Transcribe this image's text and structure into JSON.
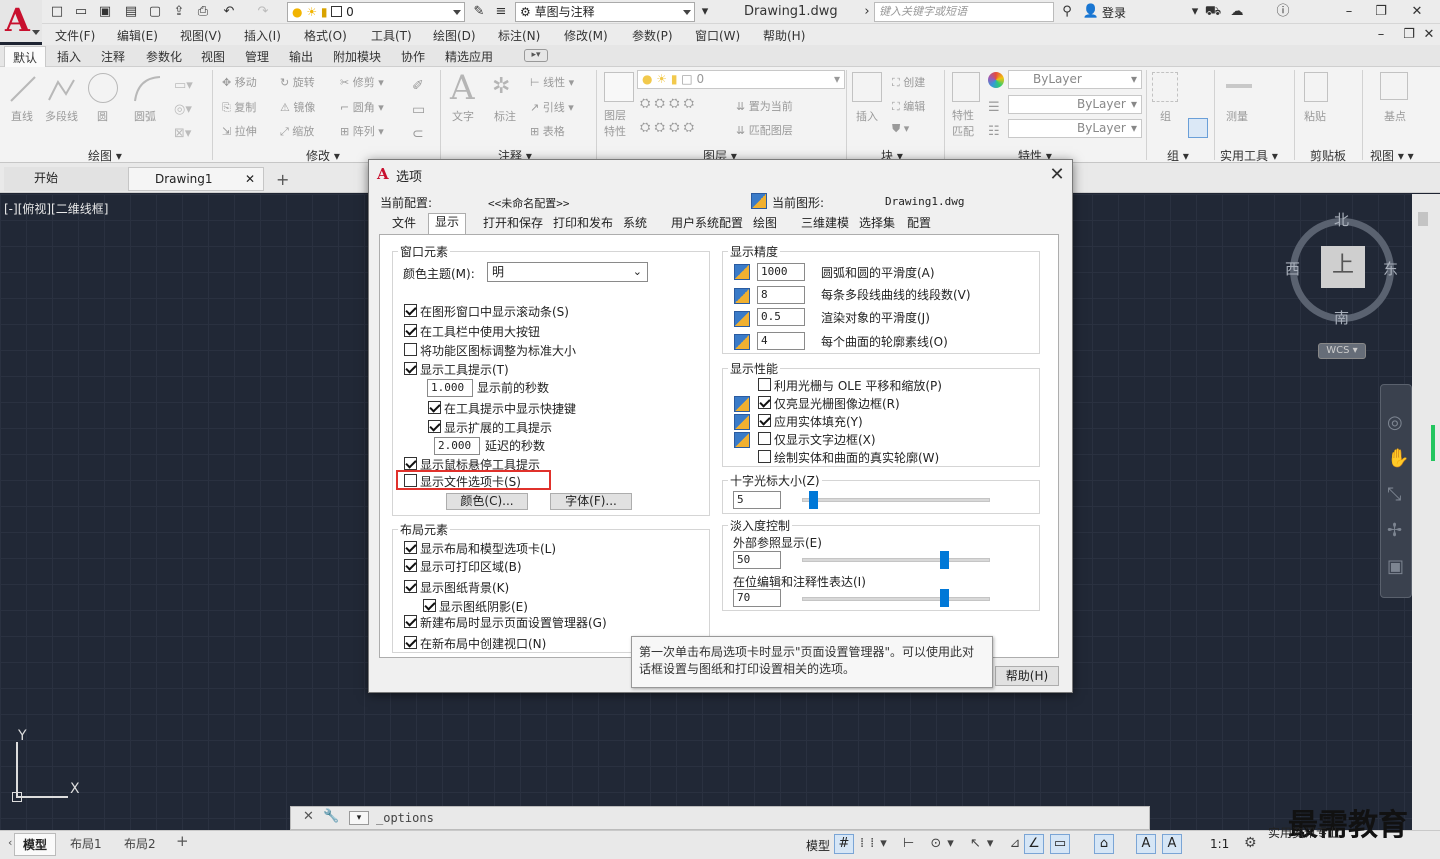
{
  "titlebar": {
    "workspace": "草图与注释",
    "layer_value": "0",
    "doc_title": "Drawing1.dwg",
    "search_placeholder": "键入关键字或短语",
    "login": "登录"
  },
  "menubar": [
    "文件(F)",
    "编辑(E)",
    "视图(V)",
    "插入(I)",
    "格式(O)",
    "工具(T)",
    "绘图(D)",
    "标注(N)",
    "修改(M)",
    "参数(P)",
    "窗口(W)",
    "帮助(H)"
  ],
  "ribbon_tabs": [
    "默认",
    "插入",
    "注释",
    "参数化",
    "视图",
    "管理",
    "输出",
    "附加模块",
    "协作",
    "精选应用"
  ],
  "ribbon": {
    "draw": {
      "title": "绘图",
      "items": [
        "直线",
        "多段线",
        "圆",
        "圆弧"
      ]
    },
    "modify": {
      "title": "修改",
      "items": [
        "移动",
        "旋转",
        "修剪",
        "复制",
        "镜像",
        "圆角",
        "拉伸",
        "缩放",
        "阵列"
      ]
    },
    "annotation": {
      "title": "注释",
      "items": [
        "文字",
        "标注",
        "线性",
        "引线",
        "表格"
      ]
    },
    "layers": {
      "title": "图层",
      "items": [
        "图层特性",
        "置为当前",
        "匹配图层"
      ],
      "value": "0"
    },
    "block": {
      "title": "块",
      "items": [
        "插入",
        "创建",
        "编辑"
      ]
    },
    "properties": {
      "title": "特性",
      "items": [
        "特性匹配"
      ],
      "bylayer": [
        "ByLayer",
        "ByLayer",
        "ByLayer"
      ]
    },
    "groups": {
      "title": "组",
      "item": "组"
    },
    "utilities": {
      "title": "实用工具",
      "item": "测量"
    },
    "clipboard": {
      "title": "剪贴板",
      "item": "粘贴"
    },
    "view": {
      "title": "视图",
      "item": "基点"
    }
  },
  "doc_tabs": [
    "开始",
    "Drawing1"
  ],
  "viewport": {
    "label": "[-][俯视][二维线框]"
  },
  "viewcube": {
    "north": "北",
    "south": "南",
    "east": "东",
    "west": "西",
    "top": "上",
    "wcs": "WCS"
  },
  "ucs": {
    "x": "X",
    "y": "Y"
  },
  "command": {
    "input": "_options"
  },
  "status": {
    "layout_tabs": [
      "模型",
      "布局1",
      "布局2"
    ],
    "model": "模型",
    "scale": "1:1"
  },
  "watermark": {
    "main": "最需教育",
    "sub": "实用资讯专业"
  },
  "dialog": {
    "title": "选项",
    "current_profile_label": "当前配置:",
    "current_profile_value": "<<未命名配置>>",
    "current_drawing_label": "当前图形:",
    "current_drawing_value": "Drawing1.dwg",
    "tabs": [
      "文件",
      "显示",
      "打开和保存",
      "打印和发布",
      "系统",
      "用户系统配置",
      "绘图",
      "三维建模",
      "选择集",
      "配置"
    ],
    "window_elements": {
      "title": "窗口元素",
      "color_theme_label": "颜色主题(M):",
      "color_theme_value": "明",
      "scrollbars": "在图形窗口中显示滚动条(S)",
      "large_buttons": "在工具栏中使用大按钮",
      "resize_ribbon": "将功能区图标调整为标准大小",
      "tooltips": "显示工具提示(T)",
      "delay_value": "1.000",
      "delay_label": "显示前的秒数",
      "shortcut_keys": "在工具提示中显示快捷键",
      "extended_tooltips": "显示扩展的工具提示",
      "ext_delay_value": "2.000",
      "ext_delay_label": "延迟的秒数",
      "rollover": "显示鼠标悬停工具提示",
      "file_tabs": "显示文件选项卡(S)",
      "colors_button": "颜色(C)...",
      "fonts_button": "字体(F)..."
    },
    "layout_elements": {
      "title": "布局元素",
      "layout_tabs": "显示布局和模型选项卡(L)",
      "printable_area": "显示可打印区域(B)",
      "paper_background": "显示图纸背景(K)",
      "paper_shadow": "显示图纸阴影(E)",
      "page_setup": "新建布局时显示页面设置管理器(G)",
      "create_viewport": "在新布局中创建视口(N)"
    },
    "display_resolution": {
      "title": "显示精度",
      "arc_value": "1000",
      "arc_label": "圆弧和圆的平滑度(A)",
      "polyline_value": "8",
      "polyline_label": "每条多段线曲线的线段数(V)",
      "render_value": "0.5",
      "render_label": "渲染对象的平滑度(J)",
      "contour_value": "4",
      "contour_label": "每个曲面的轮廓素线(O)"
    },
    "display_performance": {
      "title": "显示性能",
      "raster_ole": "利用光栅与 OLE 平移和缩放(P)",
      "raster_frame": "仅亮显光栅图像边框(R)",
      "solid_fill": "应用实体填充(Y)",
      "text_frame": "仅显示文字边框(X)",
      "silhouettes": "绘制实体和曲面的真实轮廓(W)"
    },
    "crosshair": {
      "title": "十字光标大小(Z)",
      "value": "5"
    },
    "fade": {
      "title": "淡入度控制",
      "xref_label": "外部参照显示(E)",
      "xref_value": "50",
      "inplace_label": "在位编辑和注释性表达(I)",
      "inplace_value": "70"
    },
    "tooltip": "第一次单击布局选项卡时显示\"页面设置管理器\"。可以使用此对话框设置与图纸和打印设置相关的选项。",
    "help_button": "帮助(H)"
  }
}
